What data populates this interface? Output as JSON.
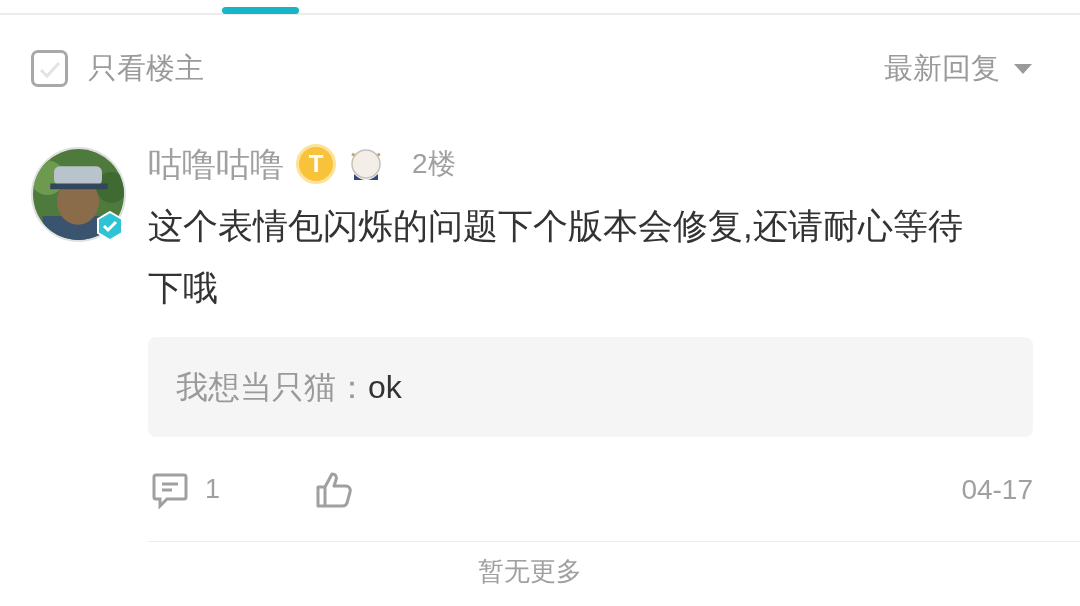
{
  "filter": {
    "label": "只看楼主",
    "checked": false
  },
  "sort": {
    "label": "最新回复"
  },
  "comment": {
    "author": "咕噜咕噜",
    "verified": true,
    "level_badge": "T",
    "floor": "2楼",
    "text": "这个表情包闪烁的问题下个版本会修复,还请耐心等待下哦",
    "reply": {
      "author": "我想当只猫：",
      "text": "ok"
    },
    "reply_count": "1",
    "date": "04-17"
  },
  "footer": "暂无更多"
}
